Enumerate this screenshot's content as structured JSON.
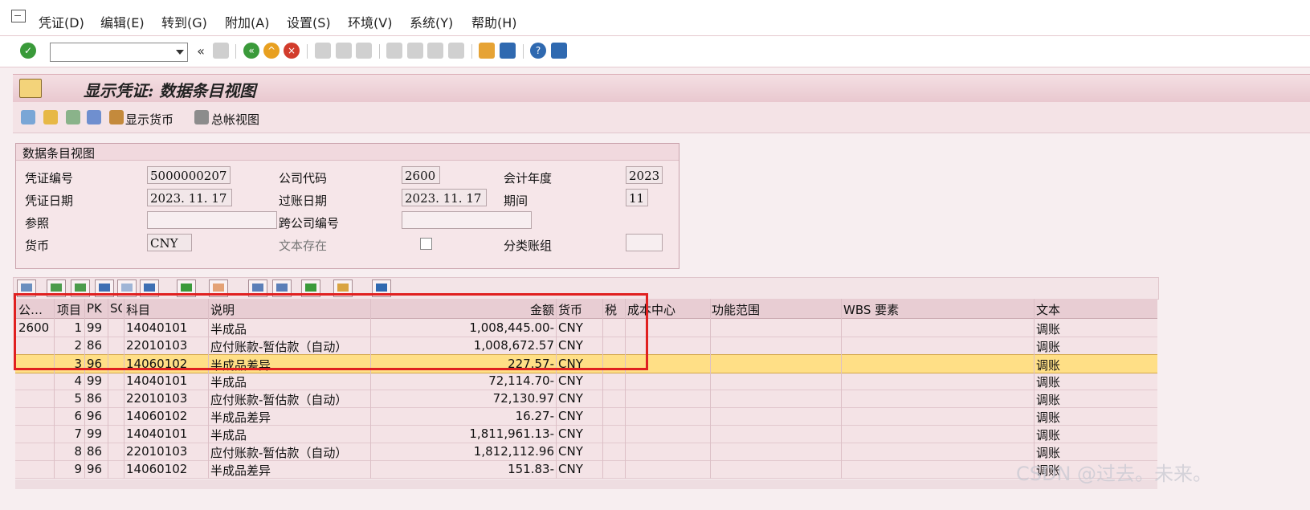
{
  "menu": [
    "凭证(D)",
    "编辑(E)",
    "转到(G)",
    "附加(A)",
    "设置(S)",
    "环境(V)",
    "系统(Y)",
    "帮助(H)"
  ],
  "toolbar": {
    "command_value": "",
    "icons": [
      "enter-icon",
      "back-nav-icon",
      "save-icon",
      "back-icon",
      "exit-icon",
      "cancel-icon",
      "print-icon",
      "find-icon",
      "find-next-icon",
      "first-page-icon",
      "previous-page-icon",
      "next-page-icon",
      "last-page-icon",
      "create-session-icon",
      "shortcut-icon",
      "help-icon",
      "layout-icon"
    ],
    "colors": {
      "green": "#3a9a3a",
      "orange": "#e8a020",
      "red": "#d23c2c",
      "blue": "#2f69b0"
    }
  },
  "title": "显示凭证: 数据条目视图",
  "app_toolbar": {
    "currency_label": "显示货币",
    "ledger_label": "总帐视图"
  },
  "header": {
    "group_title": "数据条目视图",
    "doc_no_label": "凭证编号",
    "doc_no": "5000000207",
    "company_label": "公司代码",
    "company": "2600",
    "fiscal_year_label": "会计年度",
    "fiscal_year": "2023",
    "doc_date_label": "凭证日期",
    "doc_date": "2023. 11. 17",
    "posting_date_label": "过账日期",
    "posting_date": "2023. 11. 17",
    "period_label": "期间",
    "period": "11",
    "reference_label": "参照",
    "reference": "",
    "cross_company_label": "跨公司编号",
    "cross_company": "",
    "currency_label": "货币",
    "currency": "CNY",
    "text_exists_label": "文本存在",
    "ledger_group_label": "分类账组",
    "ledger_group": ""
  },
  "grid": {
    "columns": [
      "公…",
      "项目",
      "PK",
      "SG",
      "科目",
      "说明",
      "金额",
      "货币",
      "税",
      "成本中心",
      "功能范围",
      "WBS 要素",
      "文本"
    ],
    "rows": [
      {
        "co": "2600",
        "item": "1",
        "pk": "99",
        "sg": "",
        "acct": "14040101",
        "desc": "半成品",
        "amount": "1,008,445.00-",
        "cur": "CNY",
        "text": "调账"
      },
      {
        "co": "",
        "item": "2",
        "pk": "86",
        "sg": "",
        "acct": "22010103",
        "desc": "应付账款-暂估款（自动）",
        "amount": "1,008,672.57",
        "cur": "CNY",
        "text": "调账"
      },
      {
        "co": "",
        "item": "3",
        "pk": "96",
        "sg": "",
        "acct": "14060102",
        "desc": "半成品差异",
        "amount": "227.57-",
        "cur": "CNY",
        "text": "调账"
      },
      {
        "co": "",
        "item": "4",
        "pk": "99",
        "sg": "",
        "acct": "14040101",
        "desc": "半成品",
        "amount": "72,114.70-",
        "cur": "CNY",
        "text": "调账"
      },
      {
        "co": "",
        "item": "5",
        "pk": "86",
        "sg": "",
        "acct": "22010103",
        "desc": "应付账款-暂估款（自动）",
        "amount": "72,130.97",
        "cur": "CNY",
        "text": "调账"
      },
      {
        "co": "",
        "item": "6",
        "pk": "96",
        "sg": "",
        "acct": "14060102",
        "desc": "半成品差异",
        "amount": "16.27-",
        "cur": "CNY",
        "text": "调账"
      },
      {
        "co": "",
        "item": "7",
        "pk": "99",
        "sg": "",
        "acct": "14040101",
        "desc": "半成品",
        "amount": "1,811,961.13-",
        "cur": "CNY",
        "text": "调账"
      },
      {
        "co": "",
        "item": "8",
        "pk": "86",
        "sg": "",
        "acct": "22010103",
        "desc": "应付账款-暂估款（自动）",
        "amount": "1,812,112.96",
        "cur": "CNY",
        "text": "调账"
      },
      {
        "co": "",
        "item": "9",
        "pk": "96",
        "sg": "",
        "acct": "14060102",
        "desc": "半成品差异",
        "amount": "151.83-",
        "cur": "CNY",
        "text": "调账"
      }
    ],
    "selected_row": 3
  },
  "watermark": "CSDN @过去。未来。"
}
